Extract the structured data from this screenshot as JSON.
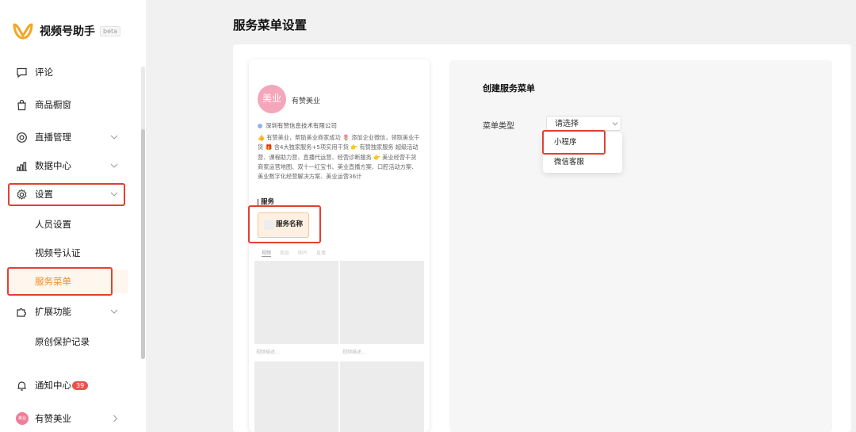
{
  "app": {
    "name": "视频号助手",
    "beta": "beta",
    "accent": "#f08a1a",
    "highlight": "#e2402f"
  },
  "sidebar": {
    "items": [
      {
        "label": "评论",
        "icon": "comment-icon"
      },
      {
        "label": "商品橱窗",
        "icon": "shopping-bag-icon"
      },
      {
        "label": "直播管理",
        "icon": "live-icon"
      },
      {
        "label": "数据中心",
        "icon": "chart-icon"
      },
      {
        "label": "设置",
        "icon": "gear-icon"
      },
      {
        "label": "扩展功能",
        "icon": "puzzle-icon"
      }
    ],
    "settings_sub": [
      "人员设置",
      "视频号认证",
      "服务菜单"
    ],
    "extension_sub": [
      "原创保护记录"
    ],
    "notification": {
      "label": "通知中心",
      "count": "39"
    },
    "account": {
      "name": "有赞美业",
      "avatar_text": "美业"
    }
  },
  "main": {
    "title": "服务菜单设置",
    "preview": {
      "avatar_text": "美业",
      "name": "有赞美业",
      "company": "深圳有赞信息技术有限公司",
      "desc": "👍 有赞美业，帮助美业商家成功 🌷 添加企业微信，领取美业干货 🎁 含4大独家服务+5项实用干货 👉 有赞独家服务 超级活动营、课程助力营、直播代运营、经营诊断服务 👉 美业经营干货 商家运营地图、双十一红宝书、美业直播方案、口腔活动方案、美业数字化经营解决方案、美业运营36计",
      "section": "服务",
      "service_name": "服务名称",
      "tabs": [
        "视频",
        "商品",
        "图片",
        "直播"
      ],
      "captions": [
        "视频描述...",
        "视频描述..."
      ]
    },
    "panel": {
      "title": "创建服务菜单",
      "menu_type_label": "菜单类型",
      "select_placeholder": "请选择",
      "options": [
        "小程序",
        "微信客服"
      ]
    }
  }
}
